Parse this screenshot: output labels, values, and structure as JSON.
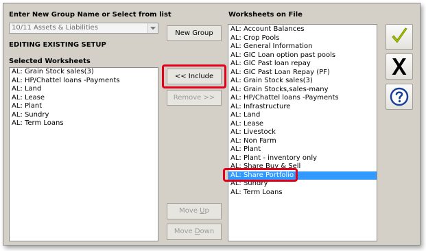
{
  "group": {
    "label": "Enter New Group Name or Select from list",
    "combo_value": "10/11 Assets & Liabilities",
    "mode_label": "EDITING EXISTING SETUP"
  },
  "selected": {
    "label": "Selected  Worksheets",
    "items": [
      "AL: Grain Stock sales(3)",
      "AL: HP/Chattel loans -Payments",
      "AL: Land",
      "AL: Lease",
      "AL: Plant",
      "AL: Sundry",
      "AL: Term Loans"
    ]
  },
  "buttons": {
    "new_group": "New Group",
    "include": "<< Include",
    "remove": "Remove >>",
    "move_up_pre": "Move ",
    "move_up_key": "U",
    "move_up_post": "p",
    "move_down_pre": "Move ",
    "move_down_key": "D",
    "move_down_post": "own"
  },
  "on_file": {
    "label": "Worksheets on File",
    "selected_index": 17,
    "items": [
      "AL: Account Balances",
      "AL: Crop Pools",
      "AL: General Information",
      "AL: GIC Loan option past pools",
      "AL: GIC Past loan repay",
      "AL: GIC Past Loan Repay (PF)",
      "AL: Grain Stock sales(3)",
      "AL: Grain Stocks,sales-many",
      "AL: HP/Chattel loans -Payments",
      "AL: Infrastructure",
      "AL: Land",
      "AL: Lease",
      "AL: Livestock",
      "AL: Non Farm",
      "AL: Plant",
      "AL: Plant - inventory only",
      "AL: Share Buy & Sell",
      "AL: Share Portfolio",
      "AL: Sundry",
      "AL: Term Loans"
    ]
  },
  "icons": {
    "ok": "checkmark-icon",
    "cancel": "x-icon",
    "help": "question-icon"
  },
  "colors": {
    "dialog_bg": "#d4d0c8",
    "selection": "#3399ff",
    "highlight": "#e2001a",
    "check": "#a8c400",
    "help": "#1a3f9a"
  }
}
